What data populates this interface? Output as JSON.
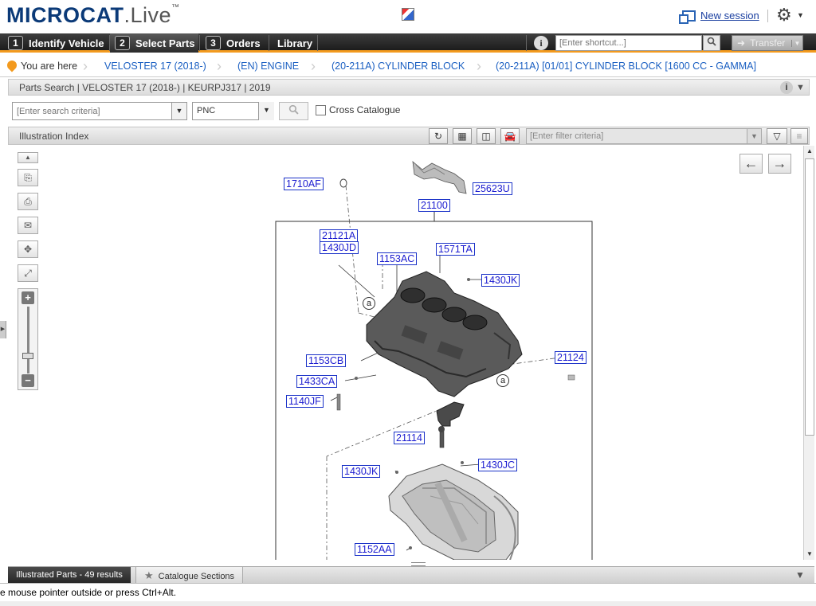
{
  "header": {
    "logo_brand": "MICROCAT",
    "logo_sep": ".",
    "logo_live": "Live",
    "logo_tm": "™",
    "new_session": "New session",
    "gear_icon": "gear-icon"
  },
  "nav": {
    "tabs": [
      {
        "num": "1",
        "label": "Identify Vehicle"
      },
      {
        "num": "2",
        "label": "Select Parts"
      },
      {
        "num": "3",
        "label": "Orders"
      },
      {
        "num": "",
        "label": "Library"
      }
    ],
    "info": "i",
    "shortcut_placeholder": "[Enter shortcut...]",
    "transfer": "Transfer"
  },
  "breadcrumb": {
    "you_are_here": "You are here",
    "items": [
      "VELOSTER 17 (2018-)",
      "(EN) ENGINE",
      "(20-211A) CYLINDER BLOCK",
      "(20-211A) [01/01] CYLINDER BLOCK [1600 CC - GAMMA]"
    ]
  },
  "parts_search": {
    "title": "Parts Search | VELOSTER 17 (2018-) | KEURPJ317 | 2019",
    "search_placeholder": "[Enter search criteria]",
    "search_type": "PNC",
    "cross_catalogue": "Cross Catalogue"
  },
  "illustration_index": {
    "title": "Illustration Index",
    "filter_placeholder": "[Enter filter criteria]"
  },
  "diagram": {
    "pncs": [
      "1710AF",
      "25623U",
      "21100",
      "21121A",
      "1430JD",
      "1153AC",
      "1571TA",
      "1430JK",
      "21124",
      "1153CB",
      "1433CA",
      "1140JF",
      "21114",
      "1430JK",
      "1430JC",
      "1152AA"
    ],
    "callout": "a"
  },
  "bottom_tabs": {
    "illustrated_parts": "Illustrated Parts - 49 results",
    "catalogue_sections": "Catalogue Sections"
  },
  "status": {
    "text": "e mouse pointer outside or press Ctrl+Alt."
  },
  "colors": {
    "accent_orange": "#f39a1e",
    "link_blue": "#1a5fc2",
    "pnc_blue": "#1b32c8"
  }
}
